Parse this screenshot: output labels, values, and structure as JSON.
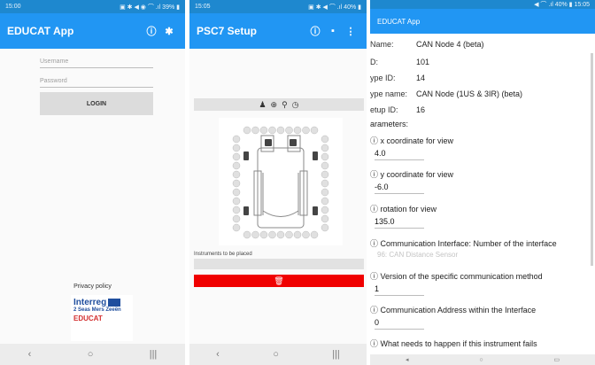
{
  "phone1": {
    "status": {
      "time": "15:00",
      "icons": "▣ ✱ ◀ ◉ ⌒ .ıl 39% ▮"
    },
    "appbar": {
      "title": "EDUCAT App",
      "info_icon": "ⓘ",
      "gear_icon": "✱"
    },
    "username_placeholder": "Username",
    "password_placeholder": "Password",
    "login_label": "LOGIN",
    "privacy_label": "Privacy policy",
    "logo": {
      "line1": "Interreg",
      "line2": "2 Seas Mers Zeeën",
      "line3": "EDUCAT"
    },
    "nav": {
      "back": "‹",
      "home": "○",
      "recents": "|||"
    }
  },
  "phone2": {
    "status": {
      "time": "15:05",
      "icons": "▣ ✱ ◀ ⌒ .ıl 40% ▮"
    },
    "appbar": {
      "title": "PSC7 Setup",
      "info_icon": "ⓘ",
      "save_icon": "▪",
      "menu_icon": "⋮"
    },
    "tool_icons": {
      "person": "♟",
      "target": "⊕",
      "sensor": "⚲",
      "clock": "◷"
    },
    "instruments_label": "Instruments to be placed",
    "delete_icon": "🗑",
    "nav": {
      "back": "‹",
      "home": "○",
      "recents": "|||"
    }
  },
  "phone3": {
    "status": {
      "icons": "◀ ⌒ .ıl 40% ▮ 15:05"
    },
    "appbar": {
      "title": "EDUCAT App"
    },
    "fields": [
      {
        "key": "Name:",
        "value": "CAN Node 4 (beta)"
      },
      {
        "key": "D:",
        "value": "101"
      },
      {
        "key": "ype ID:",
        "value": "14"
      },
      {
        "key": "ype name:",
        "value": "CAN Node (1US & 3IR) (beta)"
      },
      {
        "key": "etup ID:",
        "value": "16"
      }
    ],
    "parameters_label": "arameters:",
    "params": [
      {
        "label": "ⓘ x coordinate for view",
        "value": "4.0"
      },
      {
        "label": "ⓘ y coordinate for view",
        "value": "-6.0"
      },
      {
        "label": "ⓘ rotation for view",
        "value": "135.0"
      },
      {
        "label": "ⓘ Communication Interface: Number of the interface",
        "select": "96: CAN Distance Sensor"
      },
      {
        "label": "ⓘ Version of the specific communication method",
        "value": "1"
      },
      {
        "label": "ⓘ Communication Address within the Interface",
        "value": "0"
      },
      {
        "label": "ⓘ What needs to happen if this instrument fails"
      }
    ],
    "nav": {
      "back": "◂",
      "home": "○",
      "recents": "▭"
    }
  }
}
